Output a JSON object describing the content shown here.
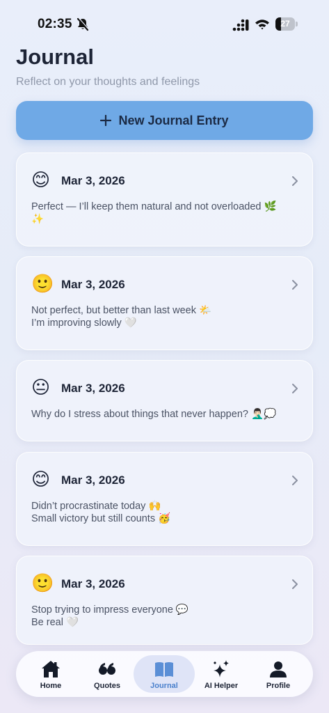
{
  "status_bar": {
    "time": "02:35",
    "battery": "27",
    "battery_level": 0.27
  },
  "header": {
    "title": "Journal",
    "subtitle": "Reflect on your thoughts and feelings",
    "new_entry_label": "New Journal Entry"
  },
  "entries": [
    {
      "mood": "😊",
      "date": "Mar 3, 2026",
      "lines": [
        "Perfect — I’ll keep them natural and not overloaded 🌿",
        "✨"
      ]
    },
    {
      "mood": "🙂",
      "date": "Mar 3, 2026",
      "lines": [
        "Not perfect, but better than last week 🌤️",
        "I’m improving slowly 🤍"
      ]
    },
    {
      "mood": "😐",
      "date": "Mar 3, 2026",
      "lines": [
        "Why do I stress about things that never happen? 🤦🏻‍♂️💭"
      ]
    },
    {
      "mood": "😊",
      "date": "Mar 3, 2026",
      "lines": [
        "Didn’t procrastinate today 🙌",
        "Small victory but still counts 🥳"
      ]
    },
    {
      "mood": "🙂",
      "date": "Mar 3, 2026",
      "lines": [
        "Stop trying to impress everyone 💬",
        "Be real 🤍"
      ]
    }
  ],
  "tabs": [
    {
      "label": "Home",
      "icon": "home-icon"
    },
    {
      "label": "Quotes",
      "icon": "quote-icon"
    },
    {
      "label": "Journal",
      "icon": "book-icon",
      "active": true
    },
    {
      "label": "AI Helper",
      "icon": "sparkles-icon"
    },
    {
      "label": "Profile",
      "icon": "person-icon"
    }
  ],
  "colors": {
    "accent": "#6fa9e6",
    "active_tab": "#4a80cc",
    "active_tab_bg": "#dfe4f7"
  }
}
